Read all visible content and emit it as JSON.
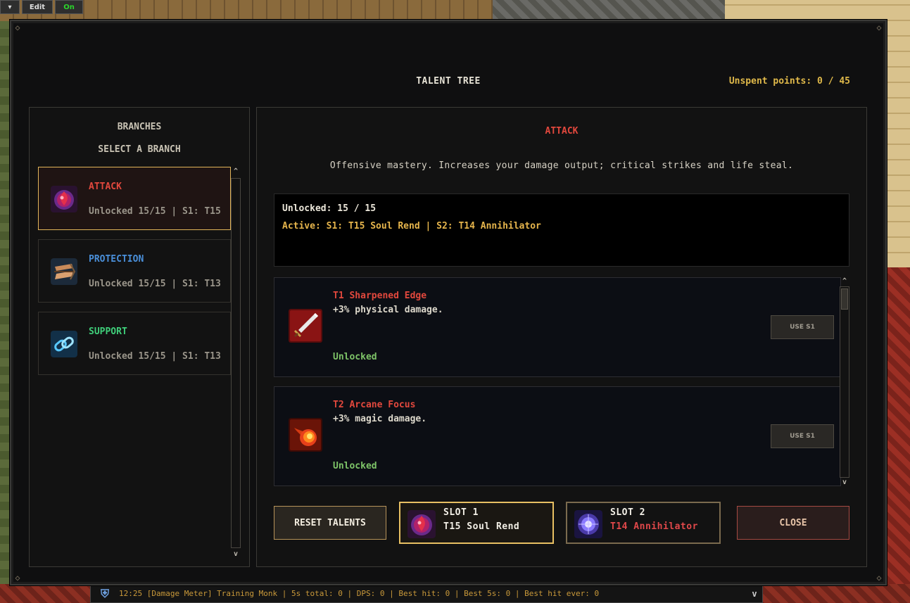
{
  "hud": {
    "arrow_label": "▾",
    "edit_label": "Edit",
    "on_label": "On"
  },
  "chat": {
    "text": "12:25 [Damage Meter] Training Monk | 5s total: 0 | DPS: 0 | Best hit: 0 | Best 5s: 0 | Best hit ever: 0",
    "scroll_label": "v"
  },
  "window": {
    "title": "TALENT TREE",
    "unspent_points": "Unspent points: 0 / 45"
  },
  "branches_panel": {
    "title": "BRANCHES",
    "subtitle": "SELECT A BRANCH",
    "items": [
      {
        "name": "ATTACK",
        "status": "Unlocked 15/15 | S1: T15",
        "color": "#e2483d",
        "icon": "soul-orb-icon",
        "active": true
      },
      {
        "name": "PROTECTION",
        "status": "Unlocked 15/15 | S1: T13",
        "color": "#4a8fd9",
        "icon": "shield-bow-icon",
        "active": false
      },
      {
        "name": "SUPPORT",
        "status": "Unlocked 15/15 | S1: T13",
        "color": "#3fcf7a",
        "icon": "chain-link-icon",
        "active": false
      }
    ],
    "scroll_up": "^",
    "scroll_down": "v"
  },
  "branch_detail": {
    "title": "ATTACK",
    "description": "Offensive mastery. Increases your damage output; critical strikes and life steal.",
    "unlocked": "Unlocked: 15 / 15",
    "active": "Active: S1: T15 Soul Rend | S2: T14 Annihilator",
    "talents": [
      {
        "name": "T1  Sharpened Edge",
        "desc": "+3% physical damage.",
        "status": "Unlocked",
        "button": "USE S1",
        "icon": "sword-icon"
      },
      {
        "name": "T2  Arcane Focus",
        "desc": "+3% magic damage.",
        "status": "Unlocked",
        "button": "USE S1",
        "icon": "fireball-icon"
      }
    ],
    "scroll_up": "^",
    "scroll_down": "v"
  },
  "footer": {
    "reset_label": "RESET TALENTS",
    "slot1": {
      "label": "SLOT 1",
      "value": "T15 Soul Rend",
      "color": "#f2efe6"
    },
    "slot2": {
      "label": "SLOT 2",
      "value": "T14 Annihilator",
      "color": "#e0484a"
    },
    "close_label": "CLOSE"
  },
  "colors": {
    "accent_gold": "#e0b94a",
    "attack_red": "#e2483d",
    "unlocked_green": "#7ec468"
  }
}
